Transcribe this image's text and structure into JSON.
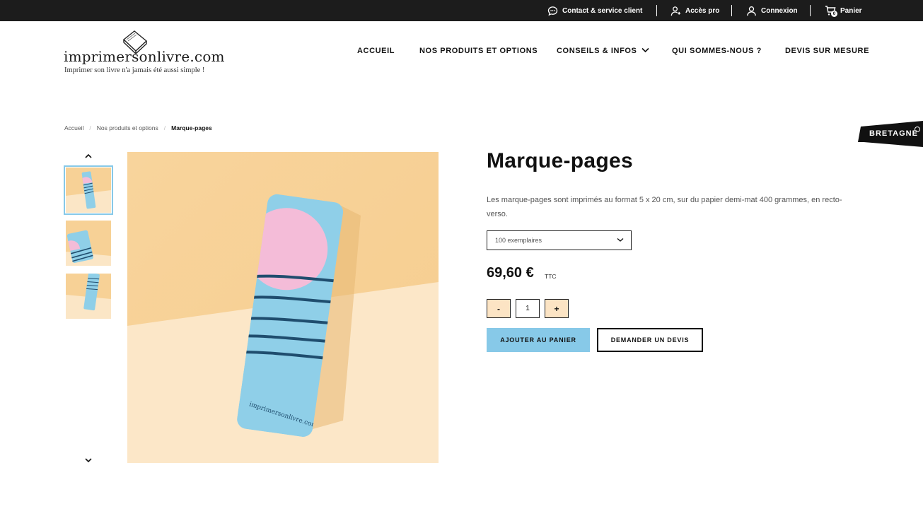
{
  "topbar": {
    "contact_label": "Contact & service client",
    "pro_label": "Accès pro",
    "login_label": "Connexion",
    "cart_label": "Panier",
    "cart_count": "0"
  },
  "logo": {
    "name": "imprimersonlivre.com",
    "tagline": "Imprimer son livre n'a jamais été aussi simple !"
  },
  "nav": {
    "items": [
      {
        "label": "ACCUEIL"
      },
      {
        "label": "NOS PRODUITS ET OPTIONS"
      },
      {
        "label": "CONSEILS & INFOS"
      },
      {
        "label": "QUI SOMMES-NOUS ?"
      },
      {
        "label": "DEVIS SUR MESURE"
      }
    ]
  },
  "breadcrumb": {
    "items": [
      "Accueil",
      "Nos produits et options",
      "Marque-pages"
    ]
  },
  "badge": {
    "label": "BRETAGNE"
  },
  "product": {
    "title": "Marque-pages",
    "description": "Les marque-pages sont imprimés au format 5 x 20 cm, sur du papier demi-mat 400 grammes, en recto-verso.",
    "quantity_option": "100 exemplaires",
    "price": "69,60 €",
    "price_suffix": "TTC",
    "quantity": "1",
    "minus_label": "-",
    "plus_label": "+",
    "add_to_cart_label": "AJOUTER AU PANIER",
    "quote_label": "DEMANDER UN DEVIS",
    "bookmark_print": "imprimersonlivre.com"
  },
  "colors": {
    "accent_blue": "#87c9e8",
    "stepper_bg": "#fce4c4",
    "topbar_bg": "#1c1c1c",
    "photo_wall": "#f7d196",
    "photo_floor": "#fbe6c6",
    "bookmark_pink": "#f4bcd8",
    "bookmark_lines": "#1f4d6e"
  }
}
